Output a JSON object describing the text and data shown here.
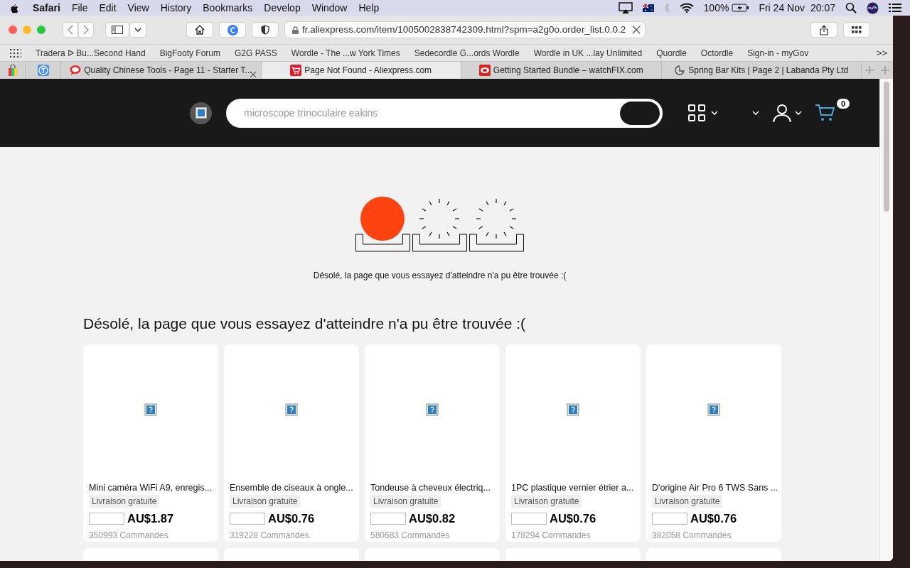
{
  "menu_bar": {
    "app": "Safari",
    "items": [
      "File",
      "Edit",
      "View",
      "History",
      "Bookmarks",
      "Develop",
      "Window",
      "Help"
    ],
    "battery": "100%",
    "date": "Fri 24 Nov",
    "time": "20:07"
  },
  "toolbar": {
    "address": "fr.aliexpress.com/item/1005002838742309.html?spm=a2g0o.order_list.0.0.2"
  },
  "bookmarks": [
    "Tradera ᐅ Bu...Second Hand",
    "BigFooty Forum",
    "G2G PASS",
    "Wordle - The ...w York Times",
    "Sedecordle G...ords Wordle",
    "Wordle in UK ...lay Unlimited",
    "Quordle",
    "Octordle",
    "Sign-in - myGov"
  ],
  "bookmarks_more": ">>",
  "tabs": [
    {
      "title": "Quality Chinese Tools - Page 11 - Starter T...",
      "selected": false,
      "hovered": true,
      "kind": "speech"
    },
    {
      "title": "Page Not Found - Aliexpress.com",
      "selected": true,
      "hovered": false,
      "kind": "cart"
    },
    {
      "title": "Getting Started Bundle – watchFIX.com",
      "selected": false,
      "hovered": false,
      "kind": "watch"
    },
    {
      "title": "Spring Bar Kits | Page 2 | Labanda Pty Ltd",
      "selected": false,
      "hovered": false,
      "kind": "clock"
    }
  ],
  "header": {
    "search_placeholder": "microscope trinoculaire eakins",
    "cart_count": "0"
  },
  "page": {
    "message": "Désolé, la page que vous essayez d'atteindre n'a pu être trouvée :(",
    "heading": "Désolé, la page que vous essayez d'atteindre n'a pu être trouvée :("
  },
  "products": [
    {
      "title": "Mini caméra WiFi A9, enregis...",
      "shipping": "Livraison gratuite",
      "price": "AU$1.87",
      "orders": "350993 Commandes"
    },
    {
      "title": "Ensemble de ciseaux à ongle...",
      "shipping": "Livraison gratuite",
      "price": "AU$0.76",
      "orders": "319228 Commandes"
    },
    {
      "title": "Tondeuse à cheveux électriq...",
      "shipping": "Livraison gratuite",
      "price": "AU$0.82",
      "orders": "580683 Commandes"
    },
    {
      "title": "1PC plastique vernier étrier a...",
      "shipping": "Livraison gratuite",
      "price": "AU$0.76",
      "orders": "178294 Commandes"
    },
    {
      "title": "D'origine Air Pro 6 TWS Sans ...",
      "shipping": "Livraison gratuite",
      "price": "AU$0.76",
      "orders": "382058 Commandes"
    }
  ]
}
